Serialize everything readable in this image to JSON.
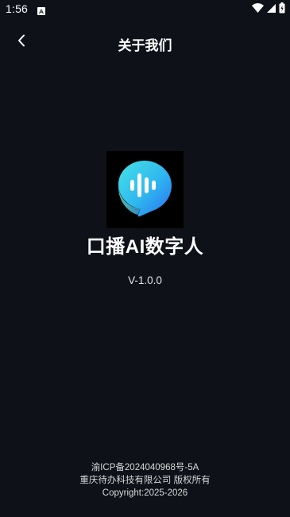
{
  "status_bar": {
    "time": "1:56",
    "icons": [
      "android-notification-icon",
      "wifi-icon",
      "signal-icon",
      "battery-icon"
    ]
  },
  "app_bar": {
    "back_icon": "chevron-left-icon",
    "title": "关于我们"
  },
  "about": {
    "logo_icon": "voice-bubble-logo-icon",
    "app_name": "口播AI数字人",
    "version": "V-1.0.0"
  },
  "footer": {
    "icp": "渝ICP备2024040968号-5A",
    "company": "重庆待办科技有限公司 版权所有",
    "copyright": "Copyright:2025-2026"
  },
  "colors": {
    "background": "#0e1118",
    "logo_gradient_start": "#3dd9e8",
    "logo_gradient_end": "#2a7bf0"
  }
}
